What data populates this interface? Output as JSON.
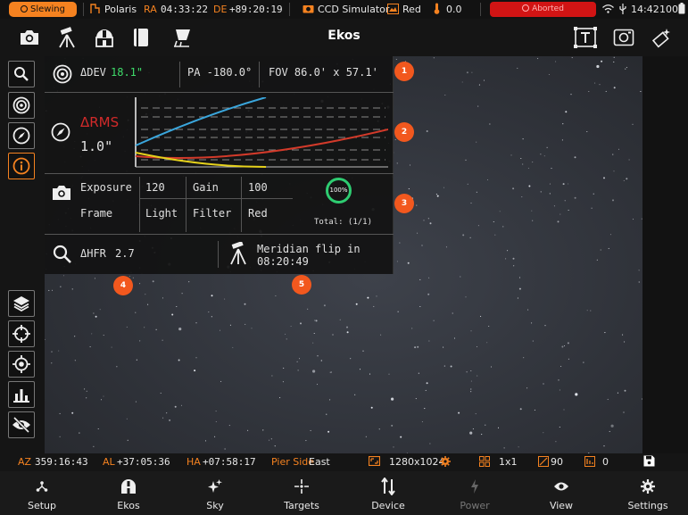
{
  "status_bar": {
    "slewing": "Slewing",
    "target_name": "Polaris",
    "ra_label": "RA",
    "ra_value": "04:33:22",
    "de_label": "DE",
    "de_value": "+89:20:19",
    "camera": "CCD Simulator",
    "filter": "Red",
    "temperature": "0.0",
    "aborted": "Aborted",
    "time": "14:42",
    "battery": "100"
  },
  "toolbar": {
    "title": "Ekos",
    "left_icons": [
      "camera-icon",
      "mount-icon",
      "observatory-icon",
      "notebook-icon",
      "flat-icon"
    ],
    "right_icons": [
      "text-frame-icon",
      "image-frame-icon",
      "wand-icon"
    ]
  },
  "left_rail": {
    "top_buttons": [
      "search-icon",
      "target-icon",
      "compass-icon",
      "info-icon"
    ],
    "bottom_buttons": [
      "layers-icon",
      "crosshair-icon",
      "gps-icon",
      "bar-chart-icon",
      "eye-off-icon"
    ]
  },
  "info_panel": {
    "row1": {
      "ddev_label": "ΔDEV",
      "ddev_value": "18.1\"",
      "pa": "PA -180.0°",
      "fov": "FOV 86.0' x 57.1'"
    },
    "row2": {
      "rms_label": "ΔRMS",
      "rms_value": "1.0\""
    },
    "row3": {
      "exposure_label": "Exposure",
      "exposure_value": "120",
      "gain_label": "Gain",
      "gain_value": "100",
      "frame_label": "Frame",
      "frame_value": "Light",
      "filter_label": "Filter",
      "filter_value": "Red",
      "progress": "100%",
      "total": "Total: (1/1)"
    },
    "row4": {
      "hfr_label": "ΔHFR",
      "hfr_value": "2.7",
      "meridian_label": "Meridian flip in",
      "meridian_value": "08:20:49"
    }
  },
  "callouts": [
    "1",
    "2",
    "3",
    "4",
    "5"
  ],
  "bottom_info": {
    "az_label": "AZ",
    "az_value": "359:16:43",
    "al_label": "AL",
    "al_value": "+37:05:36",
    "ha_label": "HA",
    "ha_value": "+07:58:17",
    "pier_label": "Pier Side",
    "pier_value": "East",
    "resolution": "1280x1024",
    "binning": "1x1",
    "angle": "90",
    "offset": "0"
  },
  "nav": {
    "setup": "Setup",
    "ekos": "Ekos",
    "sky": "Sky",
    "targets": "Targets",
    "device": "Device",
    "power": "Power",
    "view": "View",
    "settings": "Settings"
  },
  "colors": {
    "accent": "#f58220",
    "aborted": "#d11414",
    "ddev_green": "#3fdc6a",
    "rms_red": "#d22a2a",
    "callout": "#f2581e",
    "ra_series": "#3aa6dc",
    "de_series": "#d23a2a",
    "y_series": "#e6d21c"
  }
}
